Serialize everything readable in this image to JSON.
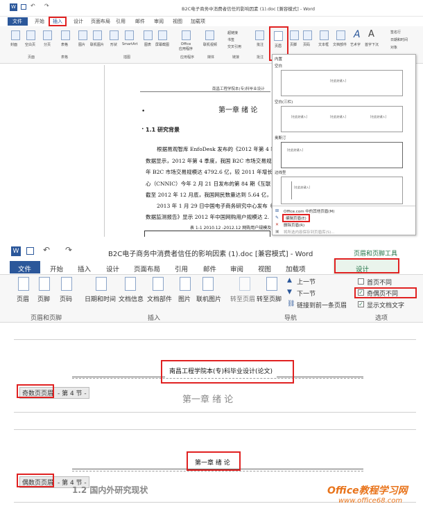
{
  "panel1": {
    "title": "B2C电子商务中消费者信任的影响因素 (1).doc [兼容模式] - Word",
    "tabs": [
      "文件",
      "开始",
      "插入",
      "设计",
      "页面布局",
      "引用",
      "邮件",
      "审阅",
      "视图",
      "加载项"
    ],
    "ribbon_items": [
      "封面",
      "空白页",
      "分页",
      "表格",
      "图片",
      "联机图片",
      "形状",
      "SmartArt",
      "图表",
      "屏幕截图",
      "Office\n应用程序",
      "联机视频",
      "超链接",
      "书签",
      "交叉引用",
      "批注",
      "页眉",
      "页脚",
      "页码",
      "文本框",
      "文档部件",
      "艺术字",
      "首字下沉",
      "签名行",
      "日期和时间",
      "对象"
    ],
    "ribbon_small": [
      "超链接",
      "书签",
      "交叉引用",
      "签名行",
      "日期和时间",
      "对象"
    ],
    "groups": [
      "页面",
      "表格",
      "插图",
      "应用程序",
      "媒体",
      "链接",
      "批注"
    ],
    "doc": {
      "header": "南昌工程学院本(专)科毕业设计",
      "chapter": "第一章  绪  论",
      "section": "1.1  研究背景",
      "lines": [
        "根据易观智库 EnfoDesk 发布的《2012 年第 4 季",
        "数据显示，2012 年第 4 季度，我国 B2C 市场交易规",
        "年 B2C 市场交易规模达 4792.6 亿，较 2011 年增长 9",
        "心（CNNIC）今年 2 月 21 日发布的第 84 期《互联",
        "截至 2012 年 12 月底，我国网民数量达到 5.64 亿，",
        "2013 年 1 月 29 日中国电子商务研究中心发布《",
        "数据监测报告》显示 2012 年中国网购用户规模达 2."
      ],
      "table_caption": "表 1-1 2010.12 -2012.12 网购用户规模及"
    },
    "gallery": {
      "sections": [
        "内置",
        "空白",
        "空白(三栏)",
        "奥斯汀",
        "边线型"
      ],
      "thumb_text": "[在此处键入]",
      "menu": [
        "Office.com 中的其他页眉(M)",
        "编辑页眉(E)",
        "删除页眉(R)",
        "将所选内容保存到页眉库(S)..."
      ]
    }
  },
  "panel2": {
    "title": "B2C电子商务中消费者信任的影响因素 (1).doc [兼容模式] - Word",
    "context_tab": "页眉和页脚工具",
    "tabs": [
      "文件",
      "开始",
      "插入",
      "设计",
      "页面布局",
      "引用",
      "邮件",
      "审阅",
      "视图",
      "加载项",
      "设计"
    ],
    "buttons": [
      "页眉",
      "页脚",
      "页码",
      "日期和时间",
      "文档信息",
      "文档部件",
      "图片",
      "联机图片",
      "转至页眉",
      "转至页脚"
    ],
    "nav": [
      "上一节",
      "下一节",
      "链接到前一条页眉"
    ],
    "options": [
      "首页不同",
      "奇偶页不同",
      "显示文档文字"
    ],
    "groups": [
      "页眉和页脚",
      "插入",
      "导航",
      "选项"
    ]
  },
  "panel3": {
    "header_text": "南昌工程学院本(专)科毕业设计(论文)",
    "tag": "奇数页页眉",
    "section": "- 第 4 节 -",
    "body": "第一章  绪  论"
  },
  "panel4": {
    "header_text": "第一章  绪  论",
    "tag": "偶数页页眉",
    "section": "- 第 4 节 -",
    "body": "1.2  国内外研究现状"
  },
  "watermark": {
    "brand": "Office教程学习网",
    "url": "www.office68.com"
  },
  "colors": {
    "word_blue": "#2b579a",
    "highlight_red": "#e02020",
    "doc_bg": "#f0f0f0",
    "context_green": "#217346"
  }
}
